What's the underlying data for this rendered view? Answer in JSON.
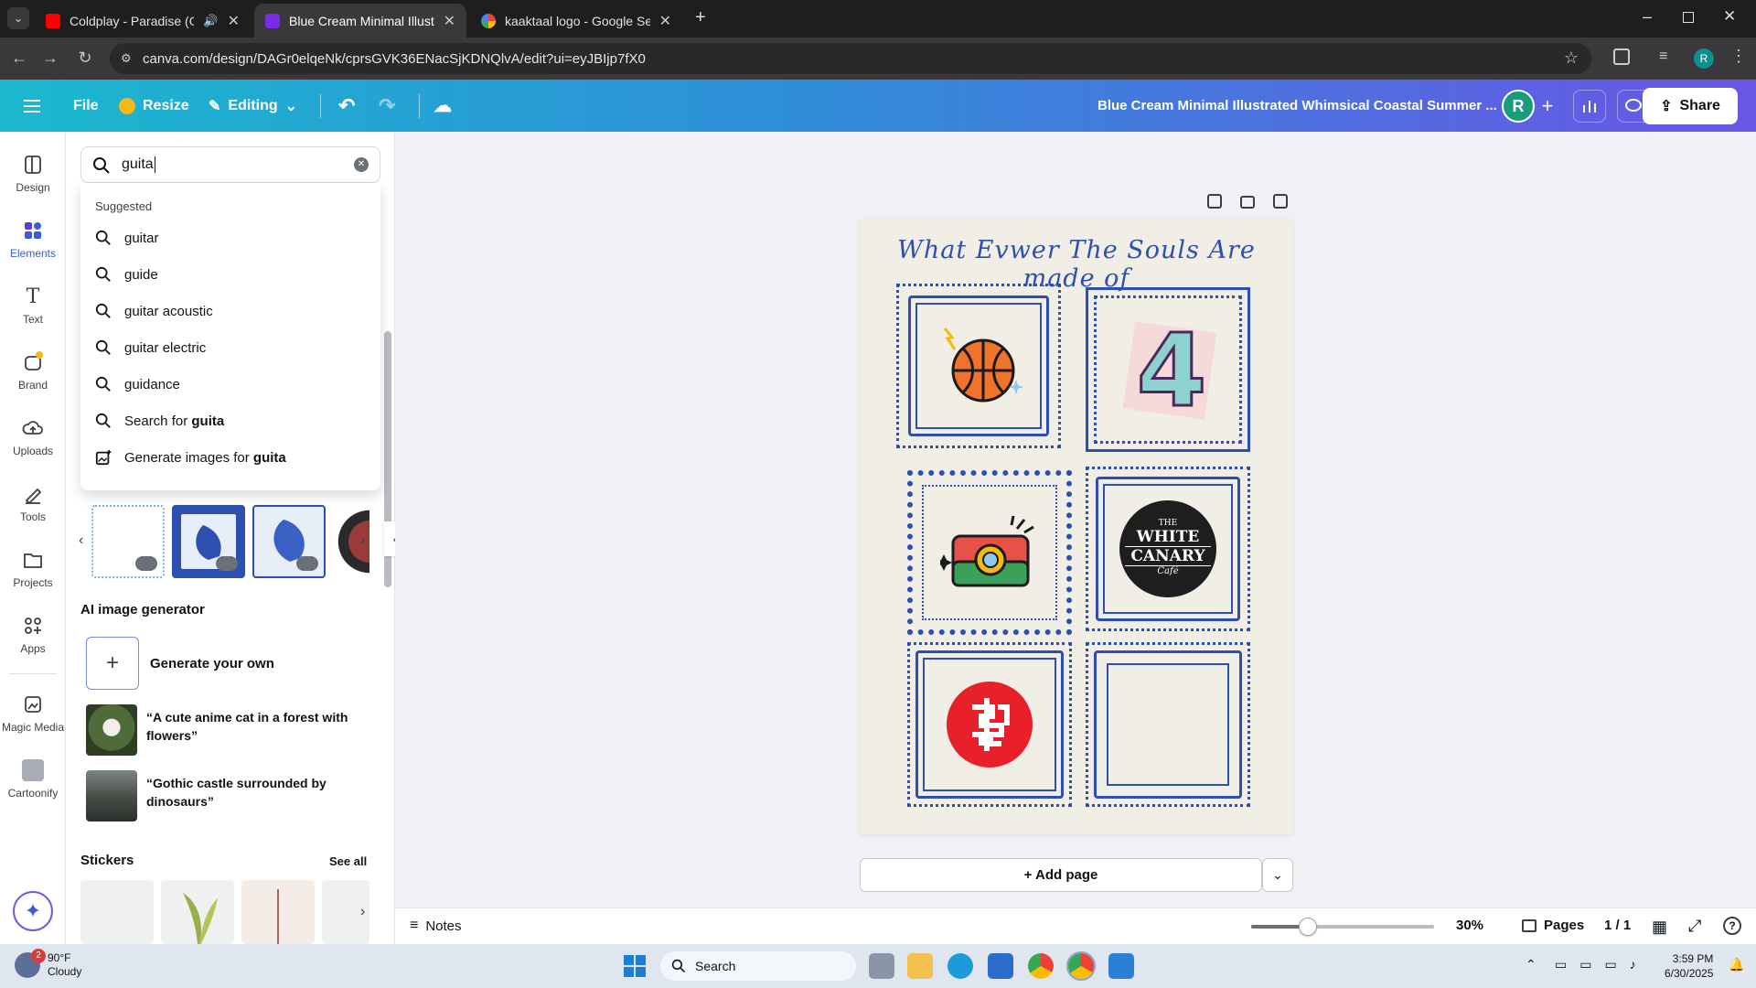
{
  "browser": {
    "tabs": [
      {
        "title": "Coldplay - Paradise (Official",
        "active": false
      },
      {
        "title": "Blue Cream Minimal Illustrated",
        "active": true
      },
      {
        "title": "kaaktaal logo - Google Search",
        "active": false
      }
    ],
    "url": "canva.com/design/DAGr0elqeNk/cprsGVK36ENacSjKDNQlvA/edit?ui=eyJBIjp7fX0"
  },
  "header": {
    "file_label": "File",
    "resize_label": "Resize",
    "editing_label": "Editing",
    "doc_title": "Blue Cream Minimal Illustrated Whimsical Coastal Summer ...",
    "avatar_letter": "R",
    "share_label": "Share"
  },
  "rail": {
    "items": [
      {
        "label": "Design"
      },
      {
        "label": "Elements"
      },
      {
        "label": "Text"
      },
      {
        "label": "Brand"
      },
      {
        "label": "Uploads"
      },
      {
        "label": "Tools"
      },
      {
        "label": "Projects"
      },
      {
        "label": "Apps"
      },
      {
        "label": "Magic Media"
      },
      {
        "label": "Cartoonify"
      }
    ]
  },
  "panel": {
    "search_value": "guita",
    "suggested_heading": "Suggested",
    "suggestions": [
      "guitar",
      "guide",
      "guitar acoustic",
      "guitar electric",
      "guidance"
    ],
    "search_for_prefix": "Search for ",
    "search_for_term": "guita",
    "generate_prefix": "Generate images for ",
    "generate_term": "guita",
    "ai_heading": "AI image generator",
    "generate_own": "Generate your own",
    "prompt1": "“A cute anime cat in a forest with flowers”",
    "prompt2": "“Gothic castle surrounded by dinosaurs”",
    "stickers_heading": "Stickers",
    "see_all": "See all"
  },
  "canvas": {
    "page_title": "What Evwer The Souls Are made of",
    "logo_line1": "THE",
    "logo_line2": "WHITE",
    "logo_line3": "CANARY",
    "logo_line4": "Café",
    "tile_number": "4",
    "add_page": "+ Add page"
  },
  "footer": {
    "notes": "Notes",
    "zoom": "30%",
    "zoom_level": 0.3,
    "pages_label": "Pages",
    "page_count": "1 / 1"
  },
  "taskbar": {
    "temp": "90°F",
    "weather": "Cloudy",
    "search": "Search",
    "time": "3:59 PM",
    "date": "6/30/2025",
    "badge": "2"
  },
  "colors": {
    "accent_blue": "#2d4fb0",
    "canva_teal": "#1bb8cf",
    "canva_purple": "#6a55e6"
  }
}
